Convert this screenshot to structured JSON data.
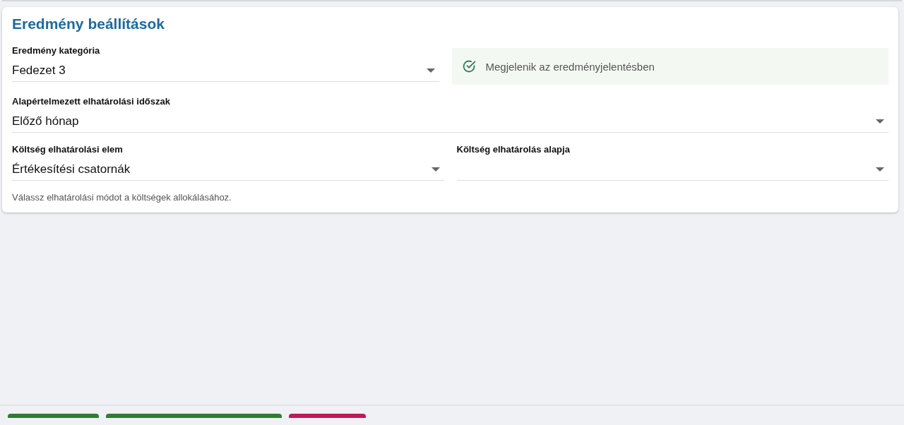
{
  "card": {
    "title": "Eredmény beállítások",
    "rows": [
      {
        "items": [
          {
            "kind": "select",
            "label": "Eredmény kategória",
            "value": "Fedezet 3"
          },
          {
            "kind": "status",
            "text": "Megjelenik az eredményjelentésben",
            "checked": true
          }
        ]
      },
      {
        "items": [
          {
            "kind": "select",
            "label": "Alapértelmezett elhatárolási időszak",
            "value": "Előző hónap"
          }
        ]
      },
      {
        "items": [
          {
            "kind": "select",
            "label": "Költség elhatárolási elem",
            "value": "Értékesítési csatornák"
          },
          {
            "kind": "select",
            "label": "Költség elhatárolás alapja"
          }
        ]
      }
    ],
    "helper": "Válassz elhatárolási módot a költségek allokálásához."
  },
  "bottom_bar": {
    "buttons": [
      {
        "color": "#2e7d32"
      },
      {
        "color": "#2e7d32"
      },
      {
        "color": "#c2185b"
      }
    ]
  }
}
